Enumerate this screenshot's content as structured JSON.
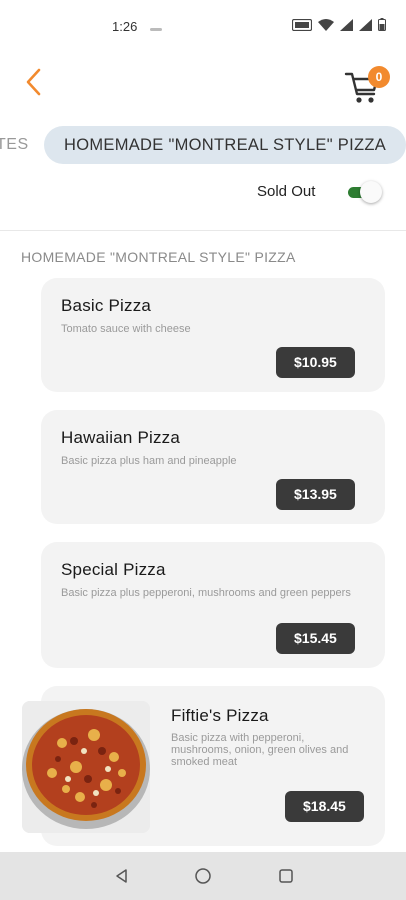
{
  "status_bar": {
    "time": "1:26"
  },
  "header": {
    "cart_count": "0"
  },
  "tabs": {
    "prev_label": "TES",
    "active_label": "HOMEMADE \"MONTREAL STYLE\" PIZZA"
  },
  "filter": {
    "sold_out_label": "Sold Out",
    "sold_out_on": true
  },
  "section": {
    "title": "HOMEMADE \"MONTREAL STYLE\" PIZZA"
  },
  "items": [
    {
      "name": "Basic Pizza",
      "description": "Tomato sauce with cheese",
      "price": "$10.95"
    },
    {
      "name": "Hawaiian Pizza",
      "description": "Basic pizza plus ham and pineapple",
      "price": "$13.95"
    },
    {
      "name": "Special Pizza",
      "description": "Basic pizza plus pepperoni, mushrooms and green peppers",
      "price": "$15.45"
    },
    {
      "name": "Fiftie's Pizza",
      "description": "Basic pizza with pepperoni, mushrooms, onion, green olives and smoked meat",
      "price": "$18.45"
    }
  ],
  "colors": {
    "accent": "#f28a2e",
    "toggle_on": "#2e7d32",
    "tab_active_bg": "#dde6ee",
    "price_bg": "#3a3a3a"
  },
  "icons": [
    "back-chevron-icon",
    "cart-icon",
    "pizza-photo",
    "nav-back-icon",
    "nav-home-icon",
    "nav-recents-icon"
  ]
}
